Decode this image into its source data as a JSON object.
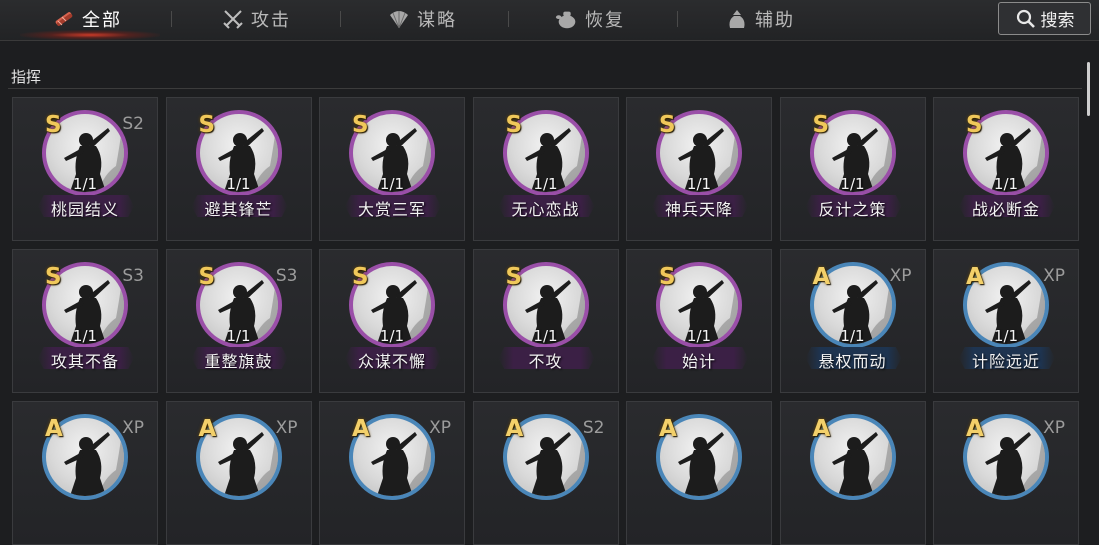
{
  "tabs": [
    {
      "label": "全部",
      "icon": "scroll-bundle-icon",
      "active": true
    },
    {
      "label": "攻击",
      "icon": "crossed-swords-icon",
      "active": false
    },
    {
      "label": "谋略",
      "icon": "fan-icon",
      "active": false
    },
    {
      "label": "恢复",
      "icon": "pot-icon",
      "active": false
    },
    {
      "label": "辅助",
      "icon": "pouch-icon",
      "active": false
    }
  ],
  "search": {
    "label": "搜索",
    "icon": "search-icon"
  },
  "section": {
    "title": "指挥"
  },
  "colors": {
    "purple_ring": "#9a4fa8",
    "blue_ring": "#4a86b8",
    "gold_grade": "#f0c85a",
    "accent_glow": "#d23c28"
  },
  "cards": [
    {
      "grade": "S",
      "tag": "S2",
      "count": "1/1",
      "name": "桃园结义",
      "quality": "purple"
    },
    {
      "grade": "S",
      "tag": "",
      "count": "1/1",
      "name": "避其锋芒",
      "quality": "purple"
    },
    {
      "grade": "S",
      "tag": "",
      "count": "1/1",
      "name": "大赏三军",
      "quality": "purple"
    },
    {
      "grade": "S",
      "tag": "",
      "count": "1/1",
      "name": "无心恋战",
      "quality": "purple"
    },
    {
      "grade": "S",
      "tag": "",
      "count": "1/1",
      "name": "神兵天降",
      "quality": "purple"
    },
    {
      "grade": "S",
      "tag": "",
      "count": "1/1",
      "name": "反计之策",
      "quality": "purple"
    },
    {
      "grade": "S",
      "tag": "",
      "count": "1/1",
      "name": "战必断金",
      "quality": "purple"
    },
    {
      "grade": "S",
      "tag": "S3",
      "count": "1/1",
      "name": "攻其不备",
      "quality": "purple"
    },
    {
      "grade": "S",
      "tag": "S3",
      "count": "1/1",
      "name": "重整旗鼓",
      "quality": "purple"
    },
    {
      "grade": "S",
      "tag": "",
      "count": "1/1",
      "name": "众谋不懈",
      "quality": "purple"
    },
    {
      "grade": "S",
      "tag": "",
      "count": "1/1",
      "name": "不攻",
      "quality": "purple"
    },
    {
      "grade": "S",
      "tag": "",
      "count": "1/1",
      "name": "始计",
      "quality": "purple"
    },
    {
      "grade": "A",
      "tag": "XP",
      "count": "1/1",
      "name": "悬权而动",
      "quality": "blue"
    },
    {
      "grade": "A",
      "tag": "XP",
      "count": "1/1",
      "name": "计险远近",
      "quality": "blue"
    },
    {
      "grade": "A",
      "tag": "XP",
      "count": "",
      "name": "",
      "quality": "blue"
    },
    {
      "grade": "A",
      "tag": "XP",
      "count": "",
      "name": "",
      "quality": "blue"
    },
    {
      "grade": "A",
      "tag": "XP",
      "count": "",
      "name": "",
      "quality": "blue"
    },
    {
      "grade": "A",
      "tag": "S2",
      "count": "",
      "name": "",
      "quality": "blue"
    },
    {
      "grade": "A",
      "tag": "",
      "count": "",
      "name": "",
      "quality": "blue"
    },
    {
      "grade": "A",
      "tag": "",
      "count": "",
      "name": "",
      "quality": "blue"
    },
    {
      "grade": "A",
      "tag": "XP",
      "count": "",
      "name": "",
      "quality": "blue"
    }
  ]
}
